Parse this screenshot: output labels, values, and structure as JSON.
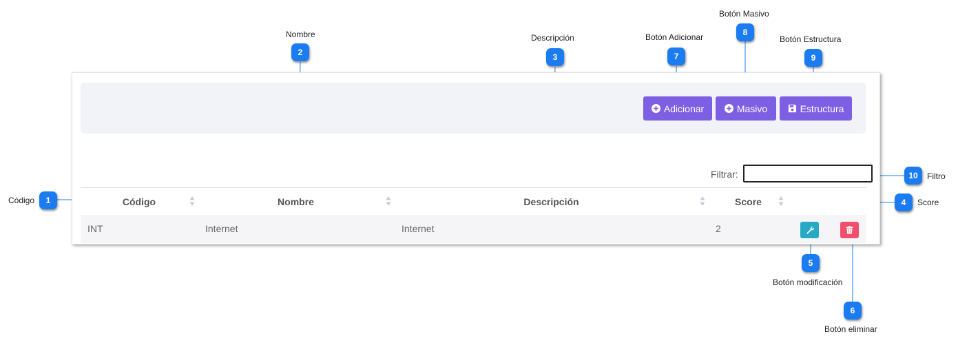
{
  "toolbar": {
    "add_label": "Adicionar",
    "bulk_label": "Masivo",
    "structure_label": "Estructura"
  },
  "filter": {
    "label": "Filtrar:",
    "value": ""
  },
  "table": {
    "columns": [
      "Código",
      "Nombre",
      "Descripción",
      "Score"
    ],
    "rows": [
      {
        "codigo": "INT",
        "nombre": "Internet",
        "descripcion": "Internet",
        "score": "2"
      }
    ]
  },
  "colors": {
    "primary_button": "#7d5fe3",
    "edit_button": "#26a9c4",
    "delete_button": "#f0506e",
    "badge": "#1a7cf0"
  },
  "callouts": [
    {
      "number": "1",
      "label": "Código"
    },
    {
      "number": "2",
      "label": "Nombre"
    },
    {
      "number": "3",
      "label": "Descripción"
    },
    {
      "number": "4",
      "label": "Score"
    },
    {
      "number": "5",
      "label": "Botón modificación"
    },
    {
      "number": "6",
      "label": "Botón eliminar"
    },
    {
      "number": "7",
      "label": "Botón Adicionar"
    },
    {
      "number": "8",
      "label": "Botón Masivo"
    },
    {
      "number": "9",
      "label": "Botón Estructura"
    },
    {
      "number": "10",
      "label": "Filtro"
    }
  ]
}
